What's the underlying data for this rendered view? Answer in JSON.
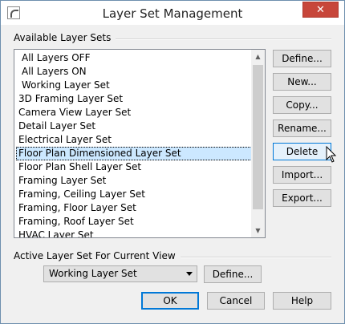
{
  "window": {
    "title": "Layer Set Management",
    "close_glyph": "✕"
  },
  "available": {
    "group_label": "Available Layer Sets",
    "items": [
      {
        "label": "All Layers OFF",
        "indent": true
      },
      {
        "label": "All Layers ON",
        "indent": true
      },
      {
        "label": "Working Layer Set",
        "indent": true
      },
      {
        "label": "3D Framing Layer Set",
        "indent": false
      },
      {
        "label": "Camera View Layer Set",
        "indent": false
      },
      {
        "label": "Detail Layer Set",
        "indent": false
      },
      {
        "label": "Electrical Layer Set",
        "indent": false
      },
      {
        "label": "Floor Plan Dimensioned Layer Set",
        "indent": false,
        "selected": true
      },
      {
        "label": "Floor Plan Shell Layer Set",
        "indent": false
      },
      {
        "label": "Framing Layer Set",
        "indent": false
      },
      {
        "label": "Framing, Ceiling Layer Set",
        "indent": false
      },
      {
        "label": "Framing, Floor Layer Set",
        "indent": false
      },
      {
        "label": "Framing, Roof Layer Set",
        "indent": false
      },
      {
        "label": "HVAC Layer Set",
        "indent": false
      }
    ],
    "scroll_up_glyph": "▲",
    "scroll_down_glyph": "▼"
  },
  "side_buttons": {
    "define": "Define...",
    "new": "New...",
    "copy": "Copy...",
    "rename": "Rename...",
    "delete": "Delete",
    "import": "Import...",
    "export": "Export..."
  },
  "active": {
    "group_label": "Active Layer Set For Current View",
    "selected_value": "Working Layer Set",
    "define_label": "Define..."
  },
  "footer": {
    "ok": "OK",
    "cancel": "Cancel",
    "help": "Help"
  },
  "colors": {
    "selection": "#cce8ff",
    "close_button": "#c7463a",
    "focus_border": "#0078d7"
  }
}
